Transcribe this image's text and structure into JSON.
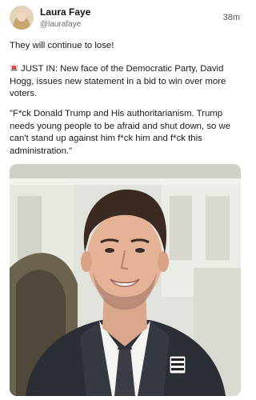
{
  "post": {
    "author": {
      "display_name": "Laura Faye",
      "handle": "@laurafaye",
      "avatar_icon": "profile-avatar"
    },
    "timestamp": "38m",
    "paragraphs": {
      "first": "They will continue to lose!",
      "second": "JUST IN: New face of the Democratic Party, David Hogg, issues new statement in a bid to win over more voters.",
      "third": "\"F*ck Donald Trump and His authoritarianism. Trump needs young people to be afraid and shut down, so we can't stand up against him f*ck him and f*ck this administration.\""
    },
    "second_paragraph_icon": "police-light-icon",
    "image": {
      "pin_text": "MARCH FOR OUR LIVES"
    }
  }
}
